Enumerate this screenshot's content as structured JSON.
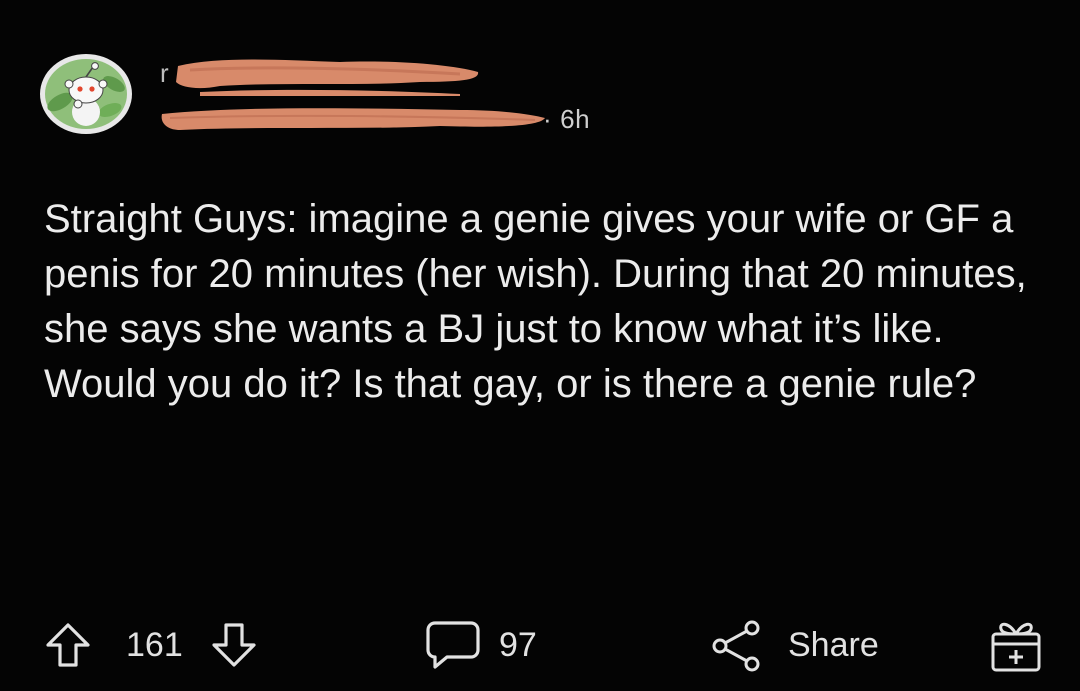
{
  "header": {
    "username_initial": "r",
    "time_ago": "6h",
    "separator": "·"
  },
  "post": {
    "title": "Straight Guys: imagine a genie gives your wife or GF a penis for 20 minutes (her wish). During that 20 minutes, she says she wants a BJ just to know what it’s like. Would you do it? Is that gay, or is there a genie rule?"
  },
  "actions": {
    "upvote_icon": "arrow-up-icon",
    "score": "161",
    "downvote_icon": "arrow-down-icon",
    "comment_icon": "speech-bubble-icon",
    "comments": "97",
    "share_icon": "share-icon",
    "share_label": "Share",
    "award_icon": "gift-box-icon"
  },
  "colors": {
    "background": "#040404",
    "text": "#ececec",
    "avatar_ring": "#e8e8e8",
    "avatar_fill": "#8fbf7a",
    "redaction": "#d88a6a"
  }
}
